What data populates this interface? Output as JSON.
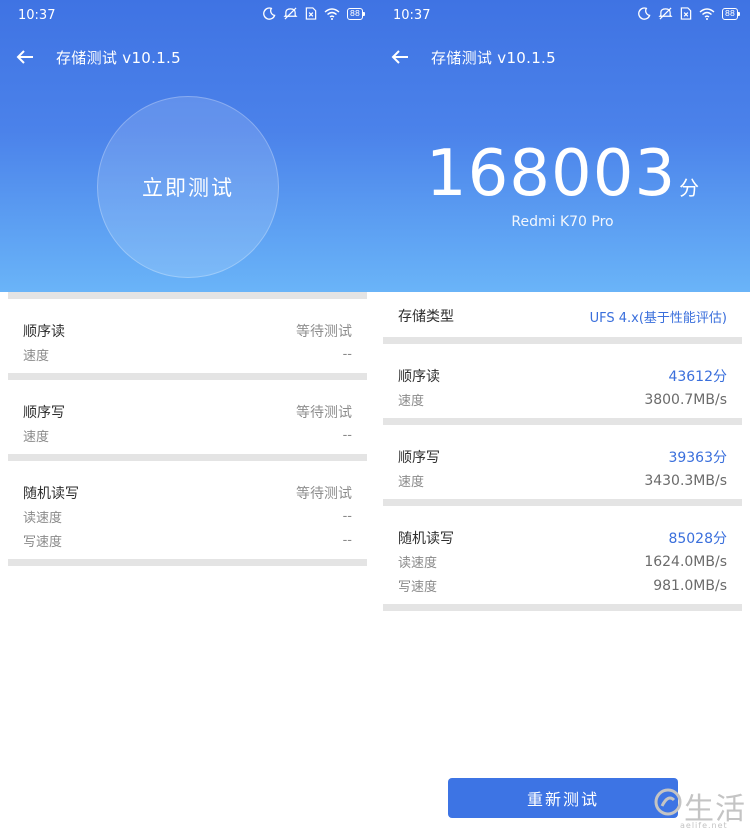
{
  "status_bar": {
    "time": "10:37",
    "battery": "88"
  },
  "app_bar": {
    "title": "存储测试 v10.1.5"
  },
  "left": {
    "start_button_label": "立即测试",
    "sections": [
      {
        "name": "顺序读",
        "state": "等待测试",
        "rows": [
          {
            "label": "速度",
            "value": "--"
          }
        ]
      },
      {
        "name": "顺序写",
        "state": "等待测试",
        "rows": [
          {
            "label": "速度",
            "value": "--"
          }
        ]
      },
      {
        "name": "随机读写",
        "state": "等待测试",
        "rows": [
          {
            "label": "读速度",
            "value": "--"
          },
          {
            "label": "写速度",
            "value": "--"
          }
        ]
      }
    ]
  },
  "right": {
    "total_score": "168003",
    "score_unit": "分",
    "device": "Redmi K70 Pro",
    "storage_type": {
      "label": "存储类型",
      "value": "UFS 4.x(基于性能评估)"
    },
    "sections": [
      {
        "name": "顺序读",
        "score": "43612分",
        "rows": [
          {
            "label": "速度",
            "value": "3800.7MB/s"
          }
        ]
      },
      {
        "name": "顺序写",
        "score": "39363分",
        "rows": [
          {
            "label": "速度",
            "value": "3430.3MB/s"
          }
        ]
      },
      {
        "name": "随机读写",
        "score": "85028分",
        "rows": [
          {
            "label": "读速度",
            "value": "1624.0MB/s"
          },
          {
            "label": "写速度",
            "value": "981.0MB/s"
          }
        ]
      }
    ],
    "retest_button_label": "重新测试"
  },
  "watermark": {
    "text": "生活",
    "url": "aelife.net"
  },
  "icons": [
    "back-arrow-icon",
    "moon-icon",
    "mute-icon",
    "sim-x-icon",
    "wifi-icon",
    "battery-icon"
  ],
  "colors": {
    "accent": "#3d74e4",
    "hero_top": "#3f73e3",
    "hero_bottom": "#6ab4f8"
  }
}
